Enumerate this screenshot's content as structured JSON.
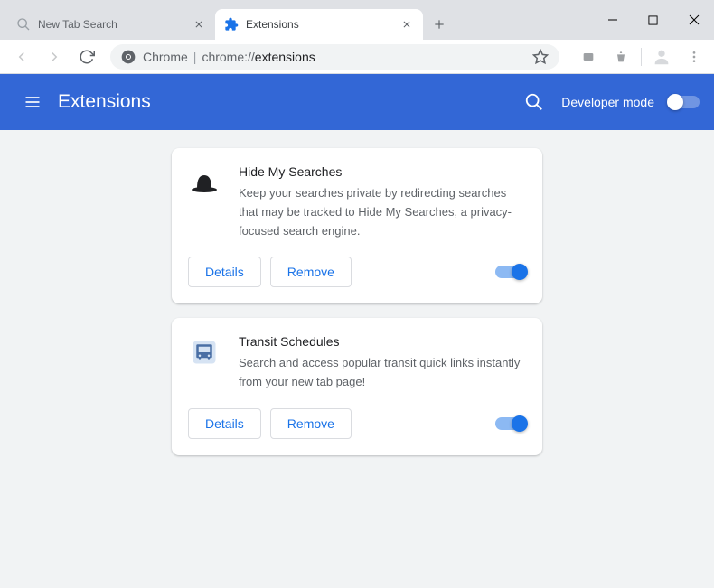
{
  "tabs": [
    {
      "title": "New Tab Search",
      "active": false
    },
    {
      "title": "Extensions",
      "active": true
    }
  ],
  "omnibox": {
    "chrome_label": "Chrome",
    "url_prefix": "chrome://",
    "url_page": "extensions"
  },
  "header": {
    "title": "Extensions",
    "dev_mode_label": "Developer mode",
    "dev_mode_on": false
  },
  "buttons": {
    "details": "Details",
    "remove": "Remove"
  },
  "extensions": [
    {
      "name": "Hide My Searches",
      "description": "Keep your searches private by redirecting searches that may be tracked to Hide My Searches, a privacy-focused search engine.",
      "enabled": true,
      "icon": "hat-icon"
    },
    {
      "name": "Transit Schedules",
      "description": "Search and access popular transit quick links instantly from your new tab page!",
      "enabled": true,
      "icon": "bus-icon"
    }
  ]
}
